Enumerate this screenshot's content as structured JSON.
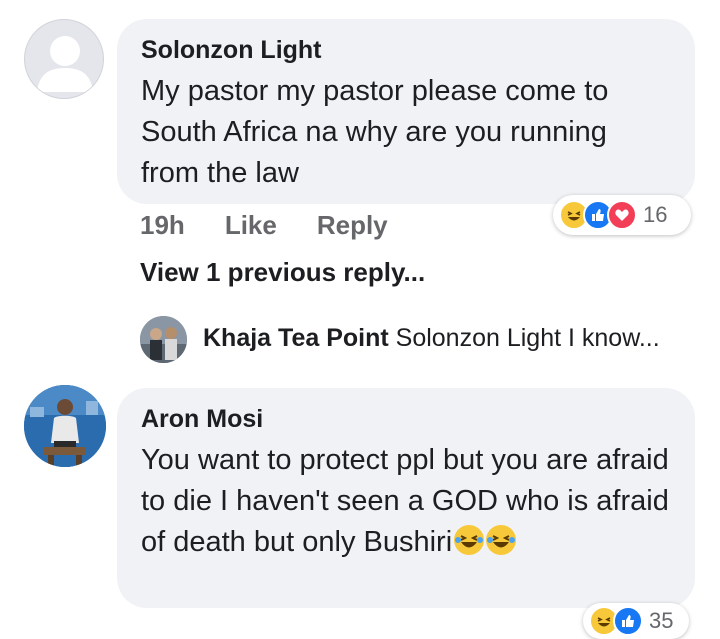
{
  "comment1": {
    "author": "Solonzon Light",
    "text": "My pastor my pastor please  come to South Africa na why are you running from the law",
    "time": "19h",
    "like_label": "Like",
    "reply_label": "Reply",
    "reactions": [
      "haha-icon",
      "like-icon",
      "love-icon"
    ],
    "reaction_count": "16"
  },
  "view_previous": "View 1 previous reply...",
  "reply": {
    "author": "Khaja Tea Point",
    "text": "Solonzon Light  I know..."
  },
  "comment2": {
    "author": "Aron Mosi",
    "text": "You want to protect ppl but you are afraid to die I haven't seen a GOD who is afraid of death but only Bushiri",
    "reactions": [
      "haha-icon",
      "like-icon"
    ],
    "reaction_count": "35"
  },
  "colors": {
    "bubble": "#f0f2f5",
    "meta_text": "#65676b",
    "like_blue": "#1877f2",
    "love_red": "#f33e58",
    "haha_yellow": "#f7c93a"
  }
}
